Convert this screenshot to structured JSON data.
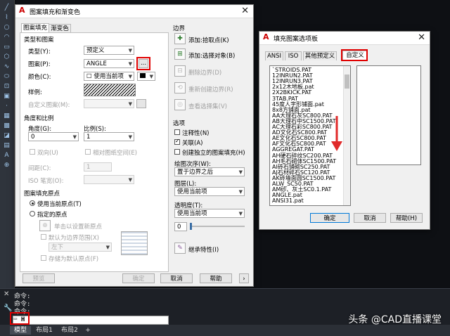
{
  "left_toolbar": {
    "icons": [
      "line-icon",
      "polyline-icon",
      "circle-icon",
      "arc-icon",
      "rectangle-icon",
      "polygon-icon",
      "spline-icon",
      "ellipse-icon",
      "insert-icon",
      "block-icon",
      "point-icon",
      "hatch-icon",
      "gradient-icon",
      "region-icon",
      "table-icon",
      "text-icon",
      "add-selected-icon"
    ]
  },
  "command": {
    "lines": [
      "命令:",
      "命令:",
      "命令:"
    ],
    "input": "H",
    "input_marker": "⌨"
  },
  "layout_tabs": {
    "model": "模型",
    "layout1": "布局1",
    "layout2": "布局2",
    "add": "+"
  },
  "watermark": "头条 @CAD直播课堂",
  "hatch_dialog": {
    "title": "图案填充和渐变色",
    "close": "✕",
    "tabs": {
      "hatch": "图案填充",
      "gradient": "渐变色"
    },
    "type_pattern_group": "类型和图案",
    "type_label": "类型(Y):",
    "type_value": "预定义",
    "pattern_label": "图案(P):",
    "pattern_value": "ANGLE",
    "browse": "...",
    "color_label": "颜色(C):",
    "color_value": "使用当前项",
    "swatch_label": "样例:",
    "custom_label": "自定义图案(M):",
    "angle_scale_group": "角度和比例",
    "angle_label": "角度(G):",
    "angle_value": "0",
    "scale_label": "比例(S):",
    "scale_value": "1",
    "double_label": "双向(U)",
    "relative_label": "相对图纸空间(E)",
    "spacing_label": "间距(C):",
    "spacing_value": "1",
    "iso_label": "ISO 笔宽(O):",
    "origin_group": "图案填充原点",
    "use_current": "使用当前原点(T)",
    "specified": "指定的原点",
    "click_set": "单击以设置新原点",
    "default_extent": "默认为边界范围(X)",
    "bottom_left": "左下",
    "store_default": "存储为默认原点(F)",
    "preview": "预览",
    "boundaries_group": "边界",
    "add_pick": "添加:拾取点(K)",
    "add_select": "添加:选择对象(B)",
    "remove_bounds": "删除边界(D)",
    "recreate": "重新创建边界(R)",
    "view_select": "查看选择集(V)",
    "options_group": "选项",
    "annotative": "注释性(N)",
    "associative": "关联(A)",
    "separate": "创建独立的图案填充(H)",
    "draw_order_label": "绘图次序(W):",
    "draw_order_value": "置于边界之后",
    "layer_label": "图层(L):",
    "layer_value": "使用当前项",
    "transparency_label": "透明度(T):",
    "transparency_value": "使用当前项",
    "transparency_num": "0",
    "inherit": "继承特性(I)",
    "ok": "确定",
    "cancel": "取消",
    "help": "帮助",
    "expand": "›"
  },
  "palette_dialog": {
    "title": "填充图案选项板",
    "close": "✕",
    "tabs": {
      "ansi": "ANSI",
      "iso": "ISO",
      "other": "其他预定义",
      "custom": "自定义"
    },
    "patterns": [
      "`STROIDS.PAT",
      "12INRUN2.PAT",
      "12INRUN3.PAT",
      "2x12木地板.pat",
      "2X2BKICK.PAT",
      "3TAB.PAT",
      "45度人字形铺面.pat",
      "8x8方铺面.pat",
      "AA大理石灰SC800.PAT",
      "AB大理石中SC1500.PAT",
      "AC大理石彩SC800.PAT",
      "AD文化石SC800.PAT",
      "AE文化石SC800.PAT",
      "AF文化石SC800.PAT",
      "AGGREGAT.PAT",
      "AH硬石碎纹SC200.PAT",
      "AH毛石砌体SC1500.PAT",
      "AI砖石铺砌SC250.PAT",
      "AJ石材碎石SC120.PAT",
      "AK砖墙面圆SC1500.PAT",
      "ALW_SC50.PAT",
      "AM砂、灰土SC0.1.PAT",
      "ANGLE.pat",
      "ANSI31.pat"
    ],
    "ok": "确定",
    "cancel": "取消",
    "help": "帮助(H)"
  },
  "colors": {
    "red_highlight": "#e00000",
    "down_arrow": "#e02a2a"
  }
}
